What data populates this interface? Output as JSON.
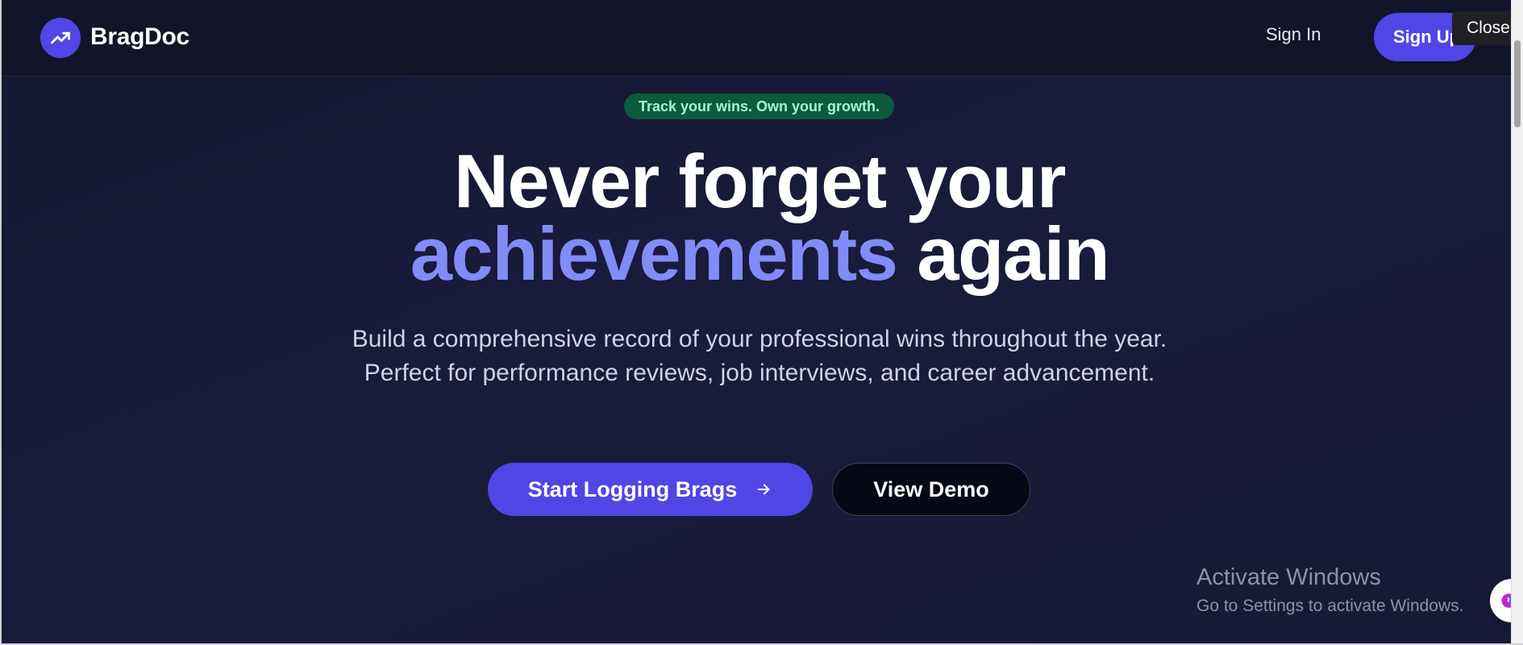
{
  "header": {
    "brand": "BragDoc",
    "signin_label": "Sign In",
    "signup_label": "Sign Up",
    "logo_icon": "trending-up-icon"
  },
  "tooltip": {
    "close_label": "Close"
  },
  "hero": {
    "badge": "Track your wins. Own your growth.",
    "headline_line1": "Never forget your",
    "headline_accent": "achievements",
    "headline_tail": "again",
    "subtitle": "Build a comprehensive record of your professional wins throughout the year. Perfect for performance reviews, job interviews, and career advancement.",
    "primary_cta": "Start Logging Brags",
    "primary_cta_icon": "arrow-right-icon",
    "secondary_cta": "View Demo"
  },
  "watermark": {
    "title": "Activate Windows",
    "subtitle": "Go to Settings to activate Windows."
  },
  "colors": {
    "accent": "#4f46e5",
    "headline_accent": "#818cf8",
    "badge_bg": "#0e5a3c",
    "badge_text": "#a7f3d0",
    "background": "#161a33"
  }
}
